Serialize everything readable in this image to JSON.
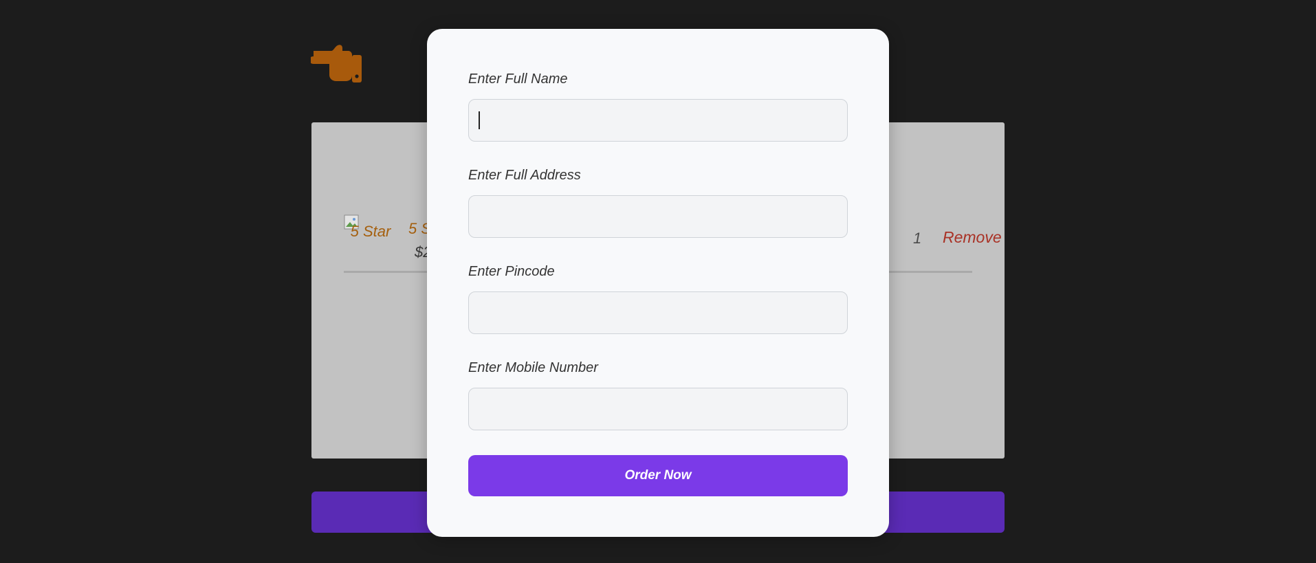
{
  "back": {
    "icon": "hand-point-left-icon",
    "color": "#a85a0c"
  },
  "cart": {
    "item": {
      "image_alt": "5 Star",
      "title": "5 Star",
      "price": "$2",
      "quantity": "1",
      "remove_label": "Remove"
    }
  },
  "checkout_form": {
    "fields": [
      {
        "label": "Enter Full Name",
        "value": "",
        "placeholder": ""
      },
      {
        "label": "Enter Full Address",
        "value": "",
        "placeholder": ""
      },
      {
        "label": "Enter Pincode",
        "value": "",
        "placeholder": ""
      },
      {
        "label": "Enter Mobile Number",
        "value": "",
        "placeholder": ""
      }
    ],
    "submit_label": "Order Now"
  },
  "colors": {
    "accent": "#7b3ae8",
    "remove": "#a93226",
    "product_text": "#a5600f",
    "backdrop": "#1c1c1c"
  }
}
